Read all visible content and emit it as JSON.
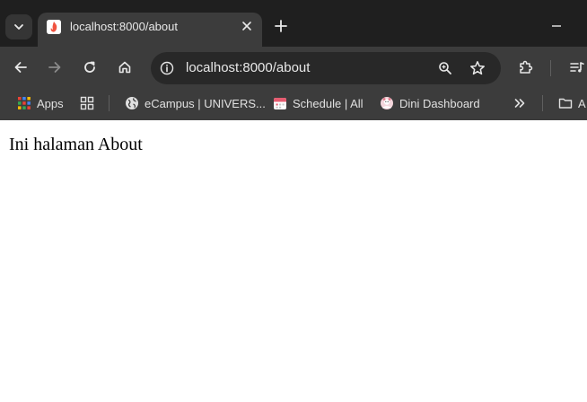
{
  "colors": {
    "tabstrip_bg": "#1f1f1f",
    "toolbar_bg": "#3c3c3c",
    "omnibox_bg": "#282828",
    "text_light": "#e8e8e8",
    "page_bg": "#ffffff"
  },
  "tab": {
    "title": "localhost:8000/about",
    "favicon": "laravel-icon"
  },
  "tabstrip": {
    "search_icon": "chevron-down-icon",
    "close_icon": "close-icon",
    "new_tab_icon": "plus-icon",
    "minimize_icon": "minimize-icon"
  },
  "toolbar": {
    "back_icon": "arrow-left-icon",
    "forward_icon": "arrow-right-icon",
    "reload_icon": "reload-icon",
    "home_icon": "home-icon",
    "extensions_icon": "puzzle-icon",
    "media_icon": "media-queue-icon"
  },
  "omnibox": {
    "url": "localhost:8000/about",
    "info_icon": "info-icon",
    "zoom_icon": "zoom-icon",
    "star_icon": "star-icon"
  },
  "bookmarks": {
    "items": [
      {
        "label": "Apps",
        "icon": "apps-grid-icon"
      },
      {
        "label": "",
        "icon": "tab-groups-icon"
      },
      {
        "label": "eCampus | UNIVERS...",
        "icon": "globe-icon"
      },
      {
        "label": "Schedule | All",
        "icon": "calendar-icon"
      },
      {
        "label": "Dini Dashboard",
        "icon": "avatar-icon"
      }
    ],
    "overflow_icon": "double-chevron-right-icon",
    "folder_label": "A",
    "folder_icon": "folder-icon"
  },
  "page": {
    "text": "Ini halaman About"
  }
}
